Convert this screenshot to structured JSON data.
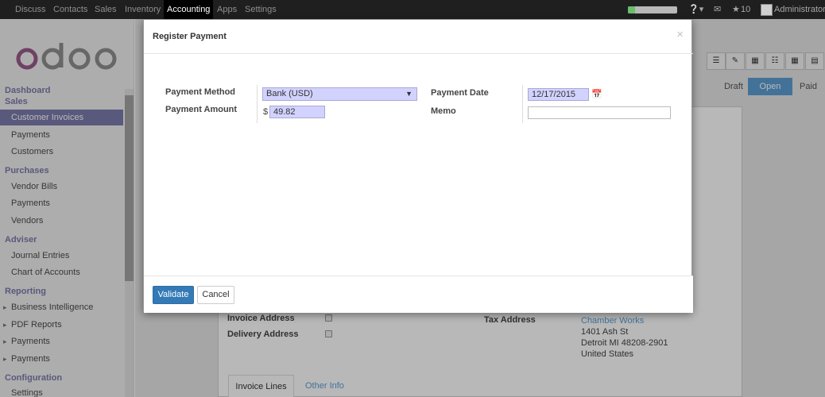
{
  "topbar": {
    "menu": [
      "Discuss",
      "Contacts",
      "Sales",
      "Inventory",
      "Accounting",
      "Apps",
      "Settings"
    ],
    "active": "Accounting",
    "progress": 0.14,
    "chat_count": "10",
    "user": "Administrator"
  },
  "logo": "odoo",
  "sidebar": {
    "dashboard": "Dashboard",
    "sales": {
      "title": "Sales",
      "items": [
        "Customer Invoices",
        "Payments",
        "Customers"
      ]
    },
    "purchases": {
      "title": "Purchases",
      "items": [
        "Vendor Bills",
        "Payments",
        "Vendors"
      ]
    },
    "adviser": {
      "title": "Adviser",
      "items": [
        "Journal Entries",
        "Chart of Accounts"
      ]
    },
    "reporting": {
      "title": "Reporting",
      "items": [
        "Business Intelligence",
        "PDF Reports",
        "Payments",
        "Payments"
      ]
    },
    "configuration": {
      "title": "Configuration",
      "items": [
        "Settings"
      ]
    }
  },
  "status": {
    "draft": "Draft",
    "open": "Open",
    "paid": "Paid"
  },
  "modal": {
    "title": "Register Payment",
    "close": "×",
    "payment_method_label": "Payment Method",
    "payment_method_value": "Bank (USD)",
    "payment_amount_label": "Payment Amount",
    "currency_symbol": "$",
    "payment_amount_value": "49.82",
    "payment_date_label": "Payment Date",
    "payment_date_value": "12/17/2015",
    "memo_label": "Memo",
    "memo_value": "",
    "validate": "Validate",
    "cancel": "Cancel"
  },
  "form": {
    "invoice_address": "Invoice Address",
    "delivery_address": "Delivery Address",
    "tax_address": "Tax Address",
    "address_lines": [
      "Chamber Works",
      "1401 Ash St",
      "Detroit MI 48208-2901",
      "United States"
    ],
    "tabs": [
      "Invoice Lines",
      "Other Info"
    ]
  },
  "colors": {
    "accent": "#7c7bad",
    "primary": "#337ab7",
    "required": "#d2d2ff",
    "status_open": "#5e9fd4"
  }
}
